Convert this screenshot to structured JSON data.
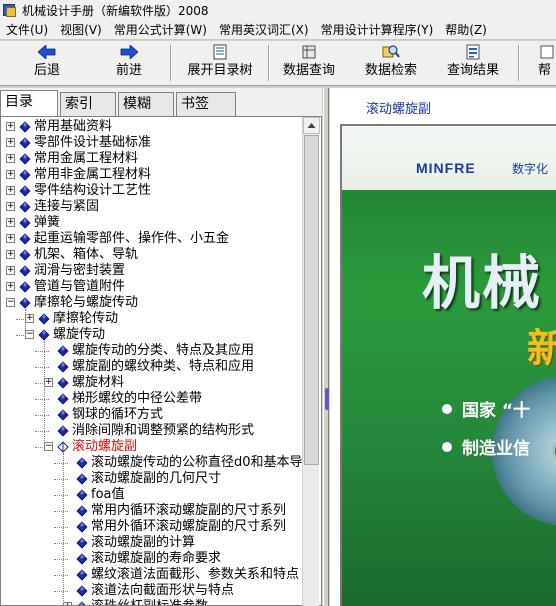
{
  "window": {
    "title": "机械设计手册（新编软件版）2008"
  },
  "menu": [
    "文件(U)",
    "视图(V)",
    "常用公式计算(W)",
    "常用英汉词汇(X)",
    "常用设计计算程序(Y)",
    "帮助(Z)"
  ],
  "toolbar": {
    "back": "后退",
    "forward": "前进",
    "expand_toc": "展开目录树",
    "data_query": "数据查询",
    "data_search": "数据检索",
    "query_result": "查询结果",
    "help": "帮"
  },
  "tabs": [
    "目录",
    "索引",
    "模糊",
    "书签"
  ],
  "tree": [
    {
      "label": "常用基础资料",
      "level": 0,
      "expander": "+",
      "icon": "diamond"
    },
    {
      "label": "零部件设计基础标准",
      "level": 0,
      "expander": "+",
      "icon": "diamond"
    },
    {
      "label": "常用金属工程材料",
      "level": 0,
      "expander": "+",
      "icon": "diamond"
    },
    {
      "label": "常用非金属工程材料",
      "level": 0,
      "expander": "+",
      "icon": "diamond"
    },
    {
      "label": "零件结构设计工艺性",
      "level": 0,
      "expander": "+",
      "icon": "diamond"
    },
    {
      "label": "连接与紧固",
      "level": 0,
      "expander": "+",
      "icon": "diamond"
    },
    {
      "label": "弹簧",
      "level": 0,
      "expander": "+",
      "icon": "diamond"
    },
    {
      "label": "起重运输零部件、操作件、小五金",
      "level": 0,
      "expander": "+",
      "icon": "diamond"
    },
    {
      "label": "机架、箱体、导轨",
      "level": 0,
      "expander": "+",
      "icon": "diamond"
    },
    {
      "label": "润滑与密封装置",
      "level": 0,
      "expander": "+",
      "icon": "diamond"
    },
    {
      "label": "管道与管道附件",
      "level": 0,
      "expander": "+",
      "icon": "diamond"
    },
    {
      "label": "摩擦轮与螺旋传动",
      "level": 0,
      "expander": "−",
      "icon": "diamond"
    },
    {
      "label": "摩擦轮传动",
      "level": 1,
      "expander": "+",
      "icon": "diamond"
    },
    {
      "label": "螺旋传动",
      "level": 1,
      "expander": "−",
      "icon": "diamond"
    },
    {
      "label": "螺旋传动的分类、特点及其应用",
      "level": 2,
      "expander": "",
      "icon": "diamond"
    },
    {
      "label": "螺旋副的螺纹种类、特点和应用",
      "level": 2,
      "expander": "",
      "icon": "diamond"
    },
    {
      "label": "螺旋材料",
      "level": 2,
      "expander": "+",
      "icon": "diamond"
    },
    {
      "label": "梯形螺纹的中径公差带",
      "level": 2,
      "expander": "",
      "icon": "diamond"
    },
    {
      "label": "钢球的循环方式",
      "level": 2,
      "expander": "",
      "icon": "diamond"
    },
    {
      "label": "消除间隙和调整预紧的结构形式",
      "level": 2,
      "expander": "",
      "icon": "diamond"
    },
    {
      "label": "滚动螺旋副",
      "level": 2,
      "expander": "−",
      "icon": "diamond-open",
      "selected": true
    },
    {
      "label": "滚动螺旋传动的公称直径d0和基本导",
      "level": 3,
      "expander": "",
      "icon": "diamond"
    },
    {
      "label": "滚动螺旋副的几何尺寸",
      "level": 3,
      "expander": "",
      "icon": "diamond"
    },
    {
      "label": "foa值",
      "level": 3,
      "expander": "",
      "icon": "diamond"
    },
    {
      "label": "常用内循环滚动螺旋副的尺寸系列",
      "level": 3,
      "expander": "",
      "icon": "diamond"
    },
    {
      "label": "常用外循环滚动螺旋副的尺寸系列",
      "level": 3,
      "expander": "",
      "icon": "diamond"
    },
    {
      "label": "滚动螺旋副的计算",
      "level": 3,
      "expander": "",
      "icon": "diamond"
    },
    {
      "label": "滚动螺旋副的寿命要求",
      "level": 3,
      "expander": "",
      "icon": "diamond"
    },
    {
      "label": "螺纹滚道法面截形、参数关系和特点",
      "level": 3,
      "expander": "",
      "icon": "diamond"
    },
    {
      "label": "滚道法向截面形状与特点",
      "level": 3,
      "expander": "",
      "icon": "diamond"
    },
    {
      "label": "滚珠丝杠副标准参数",
      "level": 3,
      "expander": "+",
      "icon": "diamond"
    }
  ],
  "content": {
    "heading": "滚动螺旋副",
    "cover": {
      "brand": "MINFRE",
      "brand_cn": "数字化",
      "title": "机械",
      "subtitle": "新",
      "bullet1": "国家 “十",
      "bullet2": "制造业信"
    }
  },
  "colors": {
    "link_blue": "#1a3aa0",
    "selected_red": "#d01010",
    "cover_green": "#2c9a3c",
    "subtitle_gold": "#f0c020"
  }
}
